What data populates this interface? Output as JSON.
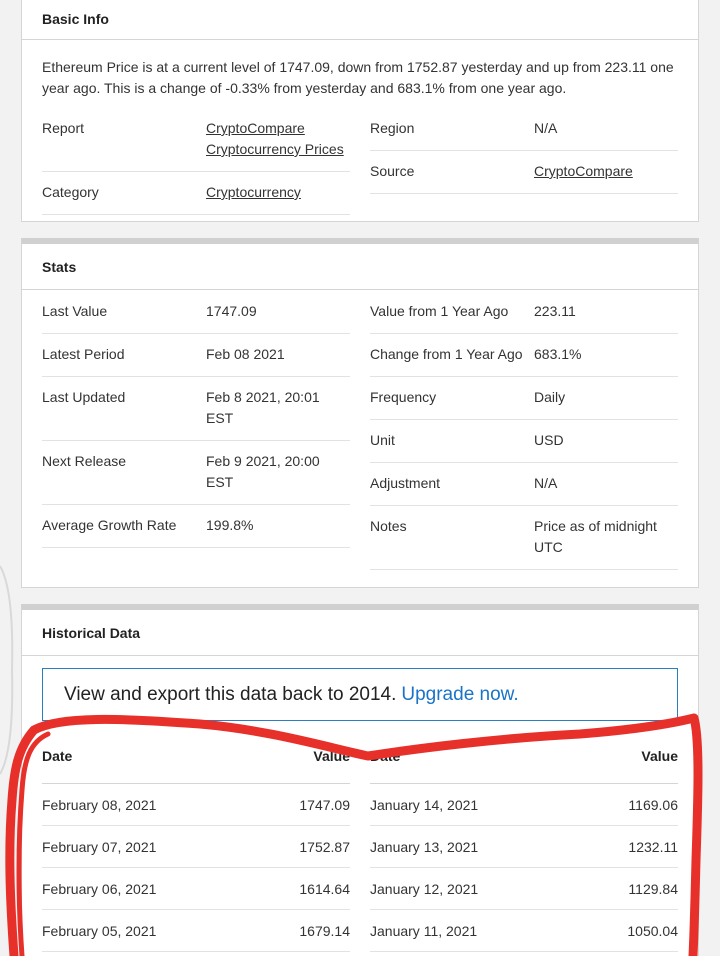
{
  "basic_info": {
    "title": "Basic Info",
    "description": "Ethereum Price is at a current level of 1747.09, down from 1752.87 yesterday and up from 223.11 one year ago. This is a change of -0.33% from yesterday and 683.1% from one year ago.",
    "left": [
      {
        "key": "Report",
        "value_line1": "CryptoCompare",
        "value_line2": "Cryptocurrency Prices"
      },
      {
        "key": "Category",
        "value": "Cryptocurrency"
      }
    ],
    "right": [
      {
        "key": "Region",
        "value": "N/A"
      },
      {
        "key": "Source",
        "value": "CryptoCompare"
      }
    ]
  },
  "stats": {
    "title": "Stats",
    "left": [
      {
        "key": "Last Value",
        "value": "1747.09"
      },
      {
        "key": "Latest Period",
        "value": "Feb 08 2021"
      },
      {
        "key": "Last Updated",
        "value": "Feb 8 2021, 20:01 EST"
      },
      {
        "key": "Next Release",
        "value": "Feb 9 2021, 20:00 EST"
      },
      {
        "key": "Average Growth Rate",
        "value": "199.8%"
      }
    ],
    "right": [
      {
        "key": "Value from 1 Year Ago",
        "value": "223.11"
      },
      {
        "key": "Change from 1 Year Ago",
        "value": "683.1%"
      },
      {
        "key": "Frequency",
        "value": "Daily"
      },
      {
        "key": "Unit",
        "value": "USD"
      },
      {
        "key": "Adjustment",
        "value": "N/A"
      },
      {
        "key": "Notes",
        "value": "Price as of midnight UTC"
      }
    ]
  },
  "historical": {
    "title": "Historical Data",
    "upgrade_text": "View and export this data back to 2014.",
    "upgrade_link": "Upgrade now.",
    "col_date": "Date",
    "col_value": "Value",
    "left_rows": [
      {
        "date": "February 08, 2021",
        "value": "1747.09"
      },
      {
        "date": "February 07, 2021",
        "value": "1752.87"
      },
      {
        "date": "February 06, 2021",
        "value": "1614.64"
      },
      {
        "date": "February 05, 2021",
        "value": "1679.14"
      }
    ],
    "right_rows": [
      {
        "date": "January 14, 2021",
        "value": "1169.06"
      },
      {
        "date": "January 13, 2021",
        "value": "1232.11"
      },
      {
        "date": "January 12, 2021",
        "value": "1129.84"
      },
      {
        "date": "January 11, 2021",
        "value": "1050.04"
      }
    ]
  },
  "annotation": {
    "color": "#e8302a"
  }
}
